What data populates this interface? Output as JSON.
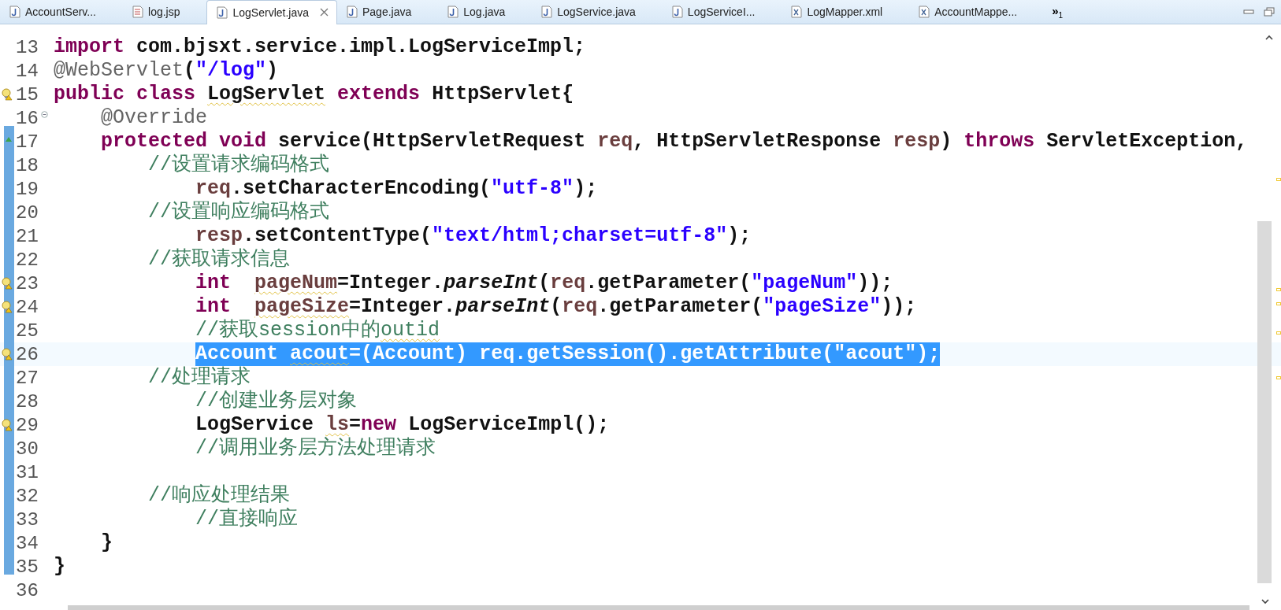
{
  "tabs": [
    {
      "label": "AccountServ...",
      "kind": "java",
      "selected": false
    },
    {
      "label": "log.jsp",
      "kind": "jsp",
      "selected": false
    },
    {
      "label": "LogServlet.java",
      "kind": "java",
      "selected": true
    },
    {
      "label": "Page.java",
      "kind": "java",
      "selected": false
    },
    {
      "label": "Log.java",
      "kind": "java",
      "selected": false
    },
    {
      "label": "LogService.java",
      "kind": "java",
      "selected": false
    },
    {
      "label": "LogServiceI...",
      "kind": "java",
      "selected": false
    },
    {
      "label": "LogMapper.xml",
      "kind": "xml",
      "selected": false
    },
    {
      "label": "AccountMappe...",
      "kind": "xml",
      "selected": false
    }
  ],
  "overflow": {
    "symbol": "»",
    "count": "1"
  },
  "lines": [
    {
      "number": "13",
      "kind": "plain",
      "current": false,
      "selected": false,
      "tokens": [
        {
          "kind": "keyword",
          "text": "import"
        },
        {
          "kind": "plain",
          "text": " com.bjsxt.service.impl.LogServiceImpl;"
        }
      ]
    },
    {
      "number": "14",
      "kind": "plain",
      "current": false,
      "selected": false,
      "tokens": [
        {
          "kind": "annotation",
          "text": "@WebServlet"
        },
        {
          "kind": "plain",
          "text": "("
        },
        {
          "kind": "string",
          "text": "\"/log\""
        },
        {
          "kind": "plain",
          "text": ")"
        }
      ]
    },
    {
      "number": "15",
      "kind": "warning",
      "current": false,
      "selected": false,
      "tokens": [
        {
          "kind": "keyword",
          "text": "public class"
        },
        {
          "kind": "warned",
          "text": " LogServlet"
        },
        {
          "kind": "keyword",
          "text": " extends"
        },
        {
          "kind": "plain",
          "text": " HttpServlet{"
        }
      ]
    },
    {
      "number": "16",
      "kind": "fold",
      "current": false,
      "selected": false,
      "tokens": [
        {
          "kind": "annotation",
          "text": "    @Override"
        }
      ]
    },
    {
      "number": "17",
      "kind": "override",
      "current": false,
      "selected": false,
      "tokens": [
        {
          "kind": "keyword",
          "text": "    protected void"
        },
        {
          "kind": "plain",
          "text": " service(HttpServletRequest "
        },
        {
          "kind": "variable",
          "text": "req"
        },
        {
          "kind": "plain",
          "text": ", HttpServletResponse "
        },
        {
          "kind": "variable",
          "text": "resp"
        },
        {
          "kind": "plain",
          "text": ") "
        },
        {
          "kind": "keyword",
          "text": "throws"
        },
        {
          "kind": "plain",
          "text": " ServletException,"
        }
      ]
    },
    {
      "number": "18",
      "kind": "plain",
      "current": false,
      "selected": false,
      "tokens": [
        {
          "kind": "comment",
          "text": "        //设置请求编码格式"
        }
      ]
    },
    {
      "number": "19",
      "kind": "plain",
      "current": false,
      "selected": false,
      "tokens": [
        {
          "kind": "variable",
          "text": "            req"
        },
        {
          "kind": "plain",
          "text": ".setCharacterEncoding("
        },
        {
          "kind": "string",
          "text": "\"utf-8\""
        },
        {
          "kind": "plain",
          "text": ");"
        }
      ]
    },
    {
      "number": "20",
      "kind": "plain",
      "current": false,
      "selected": false,
      "tokens": [
        {
          "kind": "comment",
          "text": "        //设置响应编码格式"
        }
      ]
    },
    {
      "number": "21",
      "kind": "plain",
      "current": false,
      "selected": false,
      "tokens": [
        {
          "kind": "variable",
          "text": "            resp"
        },
        {
          "kind": "plain",
          "text": ".setContentType("
        },
        {
          "kind": "string",
          "text": "\"text/html;charset=utf-8\""
        },
        {
          "kind": "plain",
          "text": ");"
        }
      ]
    },
    {
      "number": "22",
      "kind": "plain",
      "current": false,
      "selected": false,
      "tokens": [
        {
          "kind": "comment",
          "text": "        //获取请求信息"
        }
      ]
    },
    {
      "number": "23",
      "kind": "warning",
      "current": false,
      "selected": false,
      "tokens": [
        {
          "kind": "keyword",
          "text": "            int"
        },
        {
          "kind": "warned-variable",
          "text": "  pageNum"
        },
        {
          "kind": "plain",
          "text": "=Integer."
        },
        {
          "kind": "static",
          "text": "parseInt"
        },
        {
          "kind": "plain",
          "text": "("
        },
        {
          "kind": "variable",
          "text": "req"
        },
        {
          "kind": "plain",
          "text": ".getParameter("
        },
        {
          "kind": "string",
          "text": "\"pageNum\""
        },
        {
          "kind": "plain",
          "text": "));"
        }
      ]
    },
    {
      "number": "24",
      "kind": "warning",
      "current": false,
      "selected": false,
      "tokens": [
        {
          "kind": "keyword",
          "text": "            int"
        },
        {
          "kind": "warned-variable",
          "text": "  pageSize"
        },
        {
          "kind": "plain",
          "text": "=Integer."
        },
        {
          "kind": "static",
          "text": "parseInt"
        },
        {
          "kind": "plain",
          "text": "("
        },
        {
          "kind": "variable",
          "text": "req"
        },
        {
          "kind": "plain",
          "text": ".getParameter("
        },
        {
          "kind": "string",
          "text": "\"pageSize\""
        },
        {
          "kind": "plain",
          "text": "));"
        }
      ]
    },
    {
      "number": "25",
      "kind": "plain",
      "current": false,
      "selected": false,
      "tokens": [
        {
          "kind": "comment",
          "text": "            //获取session中的"
        },
        {
          "kind": "warned-comment",
          "text": "outid"
        }
      ]
    },
    {
      "number": "26",
      "kind": "warning",
      "current": true,
      "selected": true,
      "tokens": [
        {
          "kind": "plain",
          "text": "            Account"
        },
        {
          "kind": "warned-variable",
          "text": " acout"
        },
        {
          "kind": "plain",
          "text": "=(Account) "
        },
        {
          "kind": "variable",
          "text": "req"
        },
        {
          "kind": "plain",
          "text": ".getSession().getAttribute("
        },
        {
          "kind": "string",
          "text": "\"acout\""
        },
        {
          "kind": "plain",
          "text": ");"
        }
      ]
    },
    {
      "number": "27",
      "kind": "plain",
      "current": false,
      "selected": false,
      "tokens": [
        {
          "kind": "comment",
          "text": "        //处理请求"
        }
      ]
    },
    {
      "number": "28",
      "kind": "plain",
      "current": false,
      "selected": false,
      "tokens": [
        {
          "kind": "comment",
          "text": "            //创建业务层对象"
        }
      ]
    },
    {
      "number": "29",
      "kind": "warning",
      "current": false,
      "selected": false,
      "tokens": [
        {
          "kind": "plain",
          "text": "            LogService"
        },
        {
          "kind": "warned-variable",
          "text": " ls"
        },
        {
          "kind": "plain",
          "text": "="
        },
        {
          "kind": "keyword",
          "text": "new"
        },
        {
          "kind": "plain",
          "text": " LogServiceImpl();"
        }
      ]
    },
    {
      "number": "30",
      "kind": "plain",
      "current": false,
      "selected": false,
      "tokens": [
        {
          "kind": "comment",
          "text": "            //调用业务层方法处理请求"
        }
      ]
    },
    {
      "number": "31",
      "kind": "plain",
      "current": false,
      "selected": false
    },
    {
      "number": "32",
      "kind": "plain",
      "current": false,
      "selected": false,
      "tokens": [
        {
          "kind": "comment",
          "text": "        //响应处理结果"
        }
      ]
    },
    {
      "number": "33",
      "kind": "plain",
      "current": false,
      "selected": false,
      "tokens": [
        {
          "kind": "comment",
          "text": "            //直接响应"
        }
      ]
    },
    {
      "number": "34",
      "kind": "plain",
      "current": false,
      "selected": false,
      "tokens": [
        {
          "kind": "plain",
          "text": "    }"
        }
      ]
    },
    {
      "number": "35",
      "kind": "plain",
      "current": false,
      "selected": false,
      "tokens": [
        {
          "kind": "plain",
          "text": "}"
        }
      ]
    },
    {
      "number": "36",
      "kind": "plain",
      "current": false,
      "selected": false
    }
  ]
}
